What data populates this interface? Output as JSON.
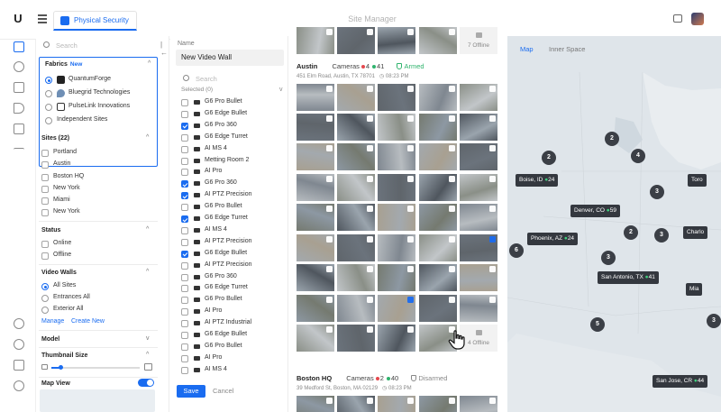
{
  "app": {
    "tab_label": "Physical Security",
    "title": "Site Manager"
  },
  "icons": {
    "logo": "ubiquiti-logo-icon",
    "menu": "hamburger-menu-icon",
    "tab": "physical-security-icon",
    "top_right": "screen-icon",
    "avatar": "user-avatar"
  },
  "colors": {
    "accent": "#1a6cf0",
    "online": "#2fb36d",
    "offline": "#e5484d",
    "map_background": "#dfe5ea",
    "cluster": "#3b3f46"
  },
  "filters": {
    "search_placeholder": "Search",
    "fabrics": {
      "title": "Fabrics",
      "badge": "New",
      "options": [
        {
          "label": "QuantumForge",
          "selected": true
        },
        {
          "label": "Bluegrid Technologies",
          "selected": false
        },
        {
          "label": "PulseLink Innovations",
          "selected": false
        },
        {
          "label": "Independent Sites",
          "selected": false
        }
      ]
    },
    "sites": {
      "title": "Sites (22)",
      "items": [
        "Portland",
        "Austin",
        "Boston HQ",
        "New York",
        "Miami",
        "New York"
      ]
    },
    "status": {
      "title": "Status",
      "items": [
        "Online",
        "Offline"
      ]
    },
    "video_walls": {
      "title": "Video Walls",
      "options": [
        {
          "label": "All Sites",
          "selected": true
        },
        {
          "label": "Entrances All",
          "selected": false
        },
        {
          "label": "Exterior All",
          "selected": false
        }
      ],
      "manage": "Manage",
      "create_new": "Create New"
    },
    "model": {
      "title": "Model"
    },
    "thumbnail_size": {
      "title": "Thumbnail Size",
      "value": 0.1
    },
    "map_view": {
      "title": "Map View",
      "enabled": true
    }
  },
  "camera_list": {
    "name_label": "Name",
    "wall_name": "New Video Wall",
    "search_placeholder": "Search",
    "selected": "Selected (0)",
    "cameras": [
      {
        "label": "G6 Pro Bullet",
        "checked": false
      },
      {
        "label": "G6 Edge Bullet",
        "checked": false
      },
      {
        "label": "G6 Pro 360",
        "checked": true
      },
      {
        "label": "G6 Edge Turret",
        "checked": false
      },
      {
        "label": "AI MS 4",
        "checked": false
      },
      {
        "label": "Metting Room 2",
        "checked": false
      },
      {
        "label": "AI Pro",
        "checked": false
      },
      {
        "label": "G6 Pro 360",
        "checked": true
      },
      {
        "label": "AI PTZ Precision",
        "checked": true
      },
      {
        "label": "G6 Pro Bullet",
        "checked": false
      },
      {
        "label": "G6 Edge Turret",
        "checked": true
      },
      {
        "label": "AI MS 4",
        "checked": false
      },
      {
        "label": "AI PTZ Precision",
        "checked": false
      },
      {
        "label": "G6 Edge Bullet",
        "checked": true
      },
      {
        "label": "AI PTZ Precision",
        "checked": false
      },
      {
        "label": "G6 Pro 360",
        "checked": false
      },
      {
        "label": "G6 Edge Turret",
        "checked": false
      },
      {
        "label": "G6 Pro Bullet",
        "checked": false
      },
      {
        "label": "AI Pro",
        "checked": false
      },
      {
        "label": "AI PTZ Industrial",
        "checked": false
      },
      {
        "label": "G6 Edge Bullet",
        "checked": false
      },
      {
        "label": "G6 Pro Bullet",
        "checked": false
      },
      {
        "label": "AI Pro",
        "checked": false
      },
      {
        "label": "AI MS 4",
        "checked": false
      }
    ],
    "save": "Save",
    "cancel": "Cancel"
  },
  "grid": {
    "top_offline": "7 Offline",
    "austin": {
      "name": "Austin",
      "cameras_label": "Cameras",
      "offline_count": "4",
      "online_count": "41",
      "status": "Armed",
      "address": "451 Elm Road, Austin, TX 78701",
      "time": "08:23 PM",
      "offline_tile": "4 Offline"
    },
    "boston": {
      "name": "Boston HQ",
      "cameras_label": "Cameras",
      "offline_count": "2",
      "online_count": "40",
      "status": "Disarmed",
      "address": "39 Medford St, Boston, MA 02129",
      "time": "08:23 PM"
    },
    "selected_tiles": [
      29,
      37
    ]
  },
  "map": {
    "tabs": [
      "Map",
      "Inner Space"
    ],
    "clusters": [
      "2",
      "2",
      "4",
      "3",
      "2",
      "3",
      "6",
      "3",
      "5",
      "3"
    ],
    "pins": [
      {
        "name": "Boise, ID",
        "count": "24"
      },
      {
        "name": "Denver, CO",
        "count": "59"
      },
      {
        "name": "Phoenix, AZ",
        "count": "24"
      },
      {
        "name": "San Antonio, TX",
        "count": "41"
      },
      {
        "name": "San Jose, CR",
        "count": "44"
      },
      {
        "name": "Toro",
        "count": ""
      },
      {
        "name": "Charlo",
        "count": ""
      },
      {
        "name": "Mia",
        "count": ""
      }
    ]
  }
}
